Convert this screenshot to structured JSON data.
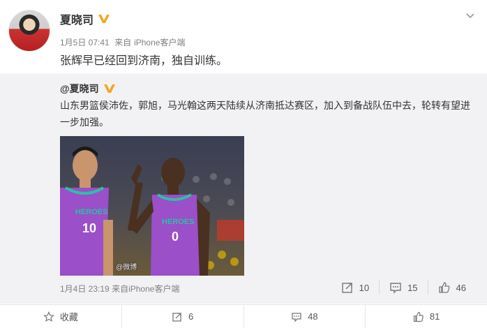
{
  "post": {
    "author": "夏晓司",
    "meta": {
      "date": "1月5日 07:41",
      "source_prefix": "来自",
      "source": "iPhone客户端"
    },
    "text": "张辉早已经回到济南，独自训练。"
  },
  "quoted": {
    "author": "@夏晓司",
    "text": "山东男篮侯沛佐，郭旭，马光翰这两天陆续从济南抵达赛区，加入到备战队伍中去，轮转有望进一步加强。",
    "photo": {
      "jersey_left": "HEROES",
      "number_left": "10",
      "jersey_right": "HEROES",
      "number_right": "0",
      "watermark": "@微博"
    },
    "meta": {
      "date": "1月4日 23:19",
      "source_prefix": "来自",
      "source": "iPhone客户端"
    },
    "actions": {
      "repost_count": "10",
      "comment_count": "15",
      "like_count": "46"
    }
  },
  "footer": {
    "favorite_label": "收藏",
    "repost_count": "6",
    "comment_count": "48",
    "like_count": "81"
  },
  "colors": {
    "verified_badge": "#f5a623",
    "jersey_purple": "#9b4fc8",
    "quote_bg": "#f2f2f5"
  }
}
